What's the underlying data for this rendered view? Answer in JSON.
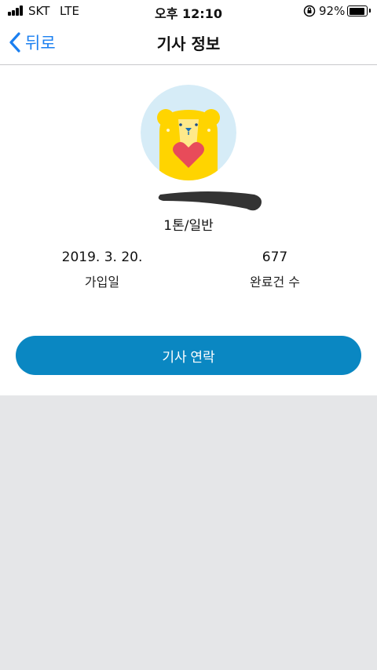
{
  "status_bar": {
    "carrier": "SKT",
    "network": "LTE",
    "time": "오후 12:10",
    "battery_percent": "92%",
    "battery_level": 0.92
  },
  "nav": {
    "back_label": "뒤로",
    "title": "기사 정보"
  },
  "profile": {
    "avatar_icon": "bear-heart-avatar-icon",
    "vehicle_type": "1톤/일반"
  },
  "stats": {
    "join_date": "2019. 3. 20.",
    "join_date_label": "가입일",
    "completed_count": "677",
    "completed_label": "완료건 수"
  },
  "actions": {
    "contact_label": "기사 연락"
  },
  "colors": {
    "accent_blue": "#1a7ff0",
    "button_blue": "#0a87c2",
    "background_gray": "#e5e6e8"
  }
}
